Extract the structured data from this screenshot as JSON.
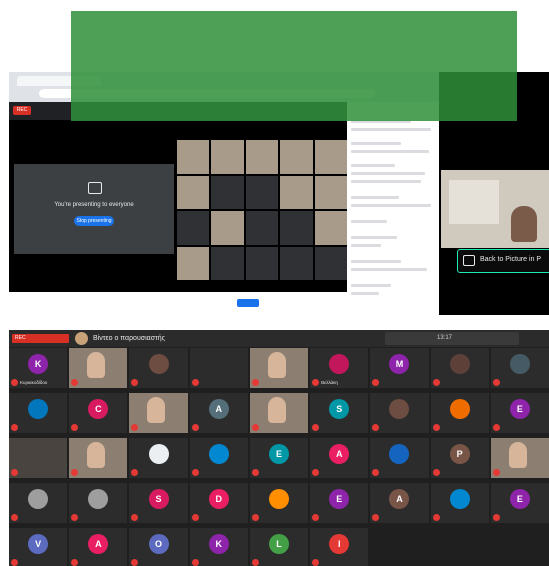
{
  "top_screenshot": {
    "pip_button_label": "Back to Picture in P",
    "presenting_text": "You're presenting to everyone",
    "stop_label": "Stop presenting"
  },
  "bottom_screenshot": {
    "header": {
      "title": "Βίντεο ο παρουσιαστής",
      "time": "13:17"
    },
    "tiles": [
      {
        "type": "avatar",
        "letter": "K",
        "color": "#8e24aa",
        "name": "Κυριακοδίδου"
      },
      {
        "type": "video"
      },
      {
        "type": "avatar",
        "letter": "",
        "color": "#6d4c41",
        "name": ""
      },
      {
        "type": "dark"
      },
      {
        "type": "video"
      },
      {
        "type": "avatar",
        "letter": "",
        "color": "#c2185b",
        "name": "Βελλάκη"
      },
      {
        "type": "avatar",
        "letter": "M",
        "color": "#8e24aa",
        "name": ""
      },
      {
        "type": "avatar",
        "letter": "",
        "color": "#5d4037",
        "name": ""
      },
      {
        "type": "avatar",
        "letter": "",
        "color": "#455a64",
        "name": ""
      },
      {
        "type": "avatar",
        "letter": "",
        "color": "#0277bd",
        "name": ""
      },
      {
        "type": "avatar",
        "letter": "C",
        "color": "#d81b60",
        "name": ""
      },
      {
        "type": "video"
      },
      {
        "type": "avatar",
        "letter": "A",
        "color": "#546e7a",
        "name": ""
      },
      {
        "type": "video"
      },
      {
        "type": "avatar",
        "letter": "S",
        "color": "#0097a7",
        "name": ""
      },
      {
        "type": "avatar",
        "letter": "",
        "color": "#6d4c41",
        "name": ""
      },
      {
        "type": "avatar",
        "letter": "",
        "color": "#ef6c00",
        "name": ""
      },
      {
        "type": "avatar",
        "letter": "E",
        "color": "#8e24aa",
        "name": ""
      },
      {
        "type": "videodark"
      },
      {
        "type": "video"
      },
      {
        "type": "avatar",
        "letter": "",
        "color": "#eceff1",
        "name": ""
      },
      {
        "type": "avatar",
        "letter": "",
        "color": "#0288d1",
        "name": ""
      },
      {
        "type": "avatar",
        "letter": "E",
        "color": "#0097a7",
        "name": ""
      },
      {
        "type": "avatar",
        "letter": "A",
        "color": "#e91e63",
        "name": ""
      },
      {
        "type": "avatar",
        "letter": "",
        "color": "#1565c0",
        "name": ""
      },
      {
        "type": "avatar",
        "letter": "P",
        "color": "#795548",
        "name": ""
      },
      {
        "type": "video"
      },
      {
        "type": "avatar",
        "letter": "",
        "color": "#9e9e9e",
        "name": ""
      },
      {
        "type": "avatar",
        "letter": "",
        "color": "#9e9e9e",
        "name": ""
      },
      {
        "type": "avatar",
        "letter": "S",
        "color": "#d81b60",
        "name": ""
      },
      {
        "type": "avatar",
        "letter": "D",
        "color": "#e91e63",
        "name": ""
      },
      {
        "type": "avatar",
        "letter": "",
        "color": "#ff8f00",
        "name": ""
      },
      {
        "type": "avatar",
        "letter": "E",
        "color": "#8e24aa",
        "name": ""
      },
      {
        "type": "avatar",
        "letter": "A",
        "color": "#795548",
        "name": ""
      },
      {
        "type": "avatar",
        "letter": "",
        "color": "#0288d1",
        "name": ""
      },
      {
        "type": "avatar",
        "letter": "E",
        "color": "#8e24aa",
        "name": ""
      },
      {
        "type": "avatar",
        "letter": "V",
        "color": "#5c6bc0",
        "name": ""
      },
      {
        "type": "avatar",
        "letter": "A",
        "color": "#e91e63",
        "name": ""
      },
      {
        "type": "avatar",
        "letter": "O",
        "color": "#5c6bc0",
        "name": ""
      },
      {
        "type": "avatar",
        "letter": "K",
        "color": "#8e24aa",
        "name": ""
      },
      {
        "type": "avatar",
        "letter": "L",
        "color": "#43a047",
        "name": ""
      },
      {
        "type": "avatar",
        "letter": "I",
        "color": "#e53935",
        "name": ""
      }
    ]
  }
}
